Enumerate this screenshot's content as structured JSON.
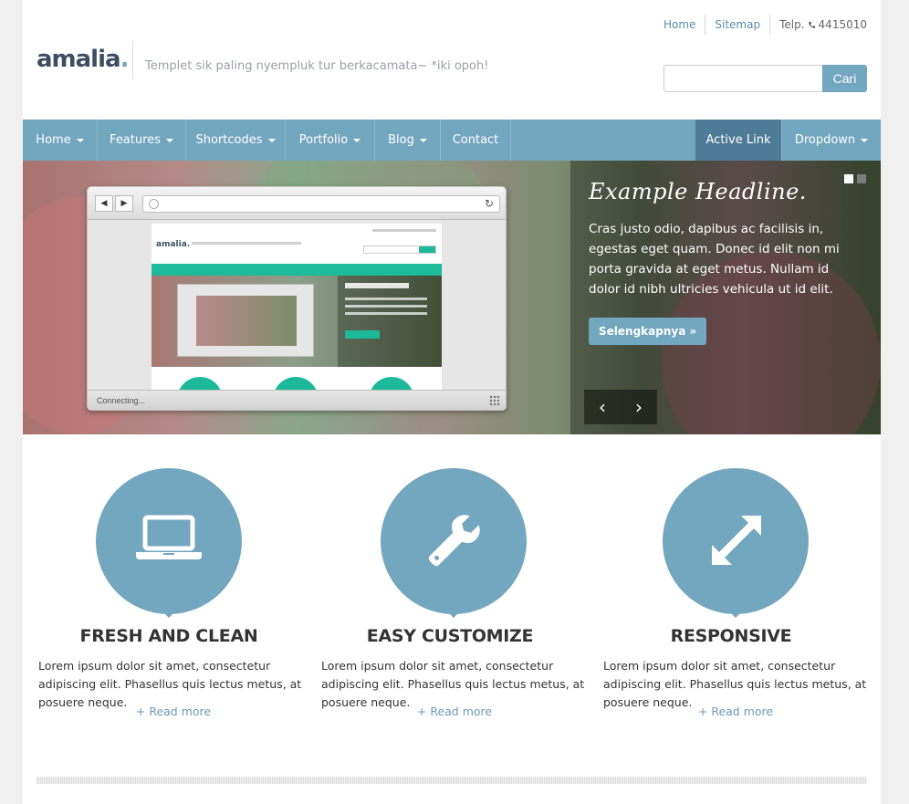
{
  "header": {
    "toplinks": [
      "Home",
      "Sitemap"
    ],
    "telp": "Telp.",
    "phone": "4415010",
    "logo_text": "amalia",
    "logo_dot": ".",
    "tagline": "Templet sik paling nyempluk tur berkacamata~ *iki opoh!"
  },
  "search": {
    "button": "Cari",
    "placeholder": ""
  },
  "nav": {
    "items": [
      "Home",
      "Features",
      "Shortcodes",
      "Portfolio",
      "Blog",
      "Contact"
    ],
    "active": "Active Link",
    "dropdown": "Dropdown"
  },
  "hero": {
    "headline": "Example Headline.",
    "body": "Cras justo odio, dapibus ac facilisis in, egestas eget quam. Donec id elit non mi porta gravida at eget metus. Nullam id dolor id nibh ultricies vehicula ut id elit.",
    "button": "Selengkapnya »",
    "browser_status": "Connecting...",
    "mini_logo": "amalia.",
    "arrow_prev": "‹",
    "arrow_next": "›"
  },
  "features": [
    {
      "icon": "laptop-icon",
      "title": "FRESH AND CLEAN",
      "text": "Lorem ipsum dolor sit amet, consectetur adipiscing elit. Phasellus quis lectus metus, at posuere neque.",
      "link": "+ Read more"
    },
    {
      "icon": "wrench-icon",
      "title": "EASY CUSTOMIZE",
      "text": "Lorem ipsum dolor sit amet, consectetur adipiscing elit. Phasellus quis lectus metus, at posuere neque.",
      "link": "+ Read more"
    },
    {
      "icon": "resize-arrows-icon",
      "title": "RESPONSIVE",
      "text": "Lorem ipsum dolor sit amet, consectetur adipiscing elit. Phasellus quis lectus metus, at posuere neque.",
      "link": "+ Read more"
    }
  ],
  "colors": {
    "accent": "#73a6bf",
    "active": "#4e7b97",
    "logo": "#3d4e63"
  }
}
